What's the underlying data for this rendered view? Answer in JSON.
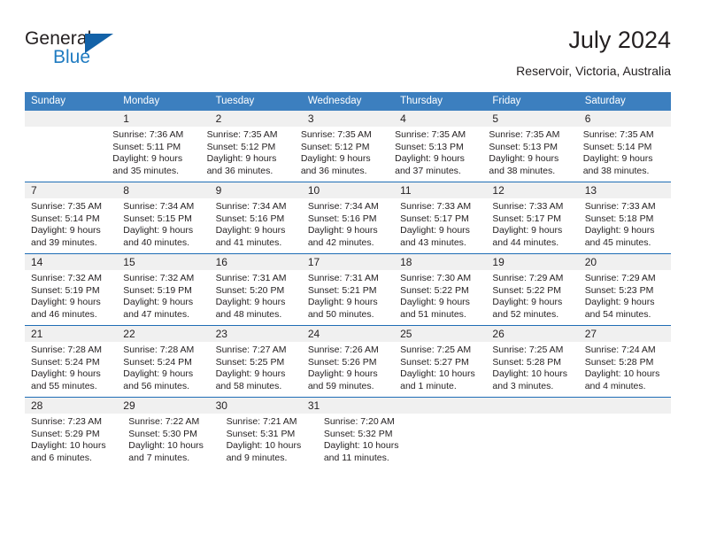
{
  "brand": {
    "name_top": "General",
    "name_bottom": "Blue",
    "accent_color": "#1362a8",
    "blue_text_color": "#1f7bc1",
    "triangle_icon": "triangle-icon"
  },
  "header": {
    "title": "July 2024",
    "subtitle": "Reservoir, Victoria, Australia"
  },
  "colors": {
    "header_row_bg": "#3c7fbf",
    "week_separator": "#1f6db5",
    "daynum_band_bg": "#f0f0f0",
    "text": "#231f20"
  },
  "weekdays": [
    "Sunday",
    "Monday",
    "Tuesday",
    "Wednesday",
    "Thursday",
    "Friday",
    "Saturday"
  ],
  "weeks": [
    {
      "days": [
        {
          "num": "",
          "lines": []
        },
        {
          "num": "1",
          "lines": [
            "Sunrise: 7:36 AM",
            "Sunset: 5:11 PM",
            "Daylight: 9 hours",
            "and 35 minutes."
          ]
        },
        {
          "num": "2",
          "lines": [
            "Sunrise: 7:35 AM",
            "Sunset: 5:12 PM",
            "Daylight: 9 hours",
            "and 36 minutes."
          ]
        },
        {
          "num": "3",
          "lines": [
            "Sunrise: 7:35 AM",
            "Sunset: 5:12 PM",
            "Daylight: 9 hours",
            "and 36 minutes."
          ]
        },
        {
          "num": "4",
          "lines": [
            "Sunrise: 7:35 AM",
            "Sunset: 5:13 PM",
            "Daylight: 9 hours",
            "and 37 minutes."
          ]
        },
        {
          "num": "5",
          "lines": [
            "Sunrise: 7:35 AM",
            "Sunset: 5:13 PM",
            "Daylight: 9 hours",
            "and 38 minutes."
          ]
        },
        {
          "num": "6",
          "lines": [
            "Sunrise: 7:35 AM",
            "Sunset: 5:14 PM",
            "Daylight: 9 hours",
            "and 38 minutes."
          ]
        }
      ]
    },
    {
      "days": [
        {
          "num": "7",
          "lines": [
            "Sunrise: 7:35 AM",
            "Sunset: 5:14 PM",
            "Daylight: 9 hours",
            "and 39 minutes."
          ]
        },
        {
          "num": "8",
          "lines": [
            "Sunrise: 7:34 AM",
            "Sunset: 5:15 PM",
            "Daylight: 9 hours",
            "and 40 minutes."
          ]
        },
        {
          "num": "9",
          "lines": [
            "Sunrise: 7:34 AM",
            "Sunset: 5:16 PM",
            "Daylight: 9 hours",
            "and 41 minutes."
          ]
        },
        {
          "num": "10",
          "lines": [
            "Sunrise: 7:34 AM",
            "Sunset: 5:16 PM",
            "Daylight: 9 hours",
            "and 42 minutes."
          ]
        },
        {
          "num": "11",
          "lines": [
            "Sunrise: 7:33 AM",
            "Sunset: 5:17 PM",
            "Daylight: 9 hours",
            "and 43 minutes."
          ]
        },
        {
          "num": "12",
          "lines": [
            "Sunrise: 7:33 AM",
            "Sunset: 5:17 PM",
            "Daylight: 9 hours",
            "and 44 minutes."
          ]
        },
        {
          "num": "13",
          "lines": [
            "Sunrise: 7:33 AM",
            "Sunset: 5:18 PM",
            "Daylight: 9 hours",
            "and 45 minutes."
          ]
        }
      ]
    },
    {
      "days": [
        {
          "num": "14",
          "lines": [
            "Sunrise: 7:32 AM",
            "Sunset: 5:19 PM",
            "Daylight: 9 hours",
            "and 46 minutes."
          ]
        },
        {
          "num": "15",
          "lines": [
            "Sunrise: 7:32 AM",
            "Sunset: 5:19 PM",
            "Daylight: 9 hours",
            "and 47 minutes."
          ]
        },
        {
          "num": "16",
          "lines": [
            "Sunrise: 7:31 AM",
            "Sunset: 5:20 PM",
            "Daylight: 9 hours",
            "and 48 minutes."
          ]
        },
        {
          "num": "17",
          "lines": [
            "Sunrise: 7:31 AM",
            "Sunset: 5:21 PM",
            "Daylight: 9 hours",
            "and 50 minutes."
          ]
        },
        {
          "num": "18",
          "lines": [
            "Sunrise: 7:30 AM",
            "Sunset: 5:22 PM",
            "Daylight: 9 hours",
            "and 51 minutes."
          ]
        },
        {
          "num": "19",
          "lines": [
            "Sunrise: 7:29 AM",
            "Sunset: 5:22 PM",
            "Daylight: 9 hours",
            "and 52 minutes."
          ]
        },
        {
          "num": "20",
          "lines": [
            "Sunrise: 7:29 AM",
            "Sunset: 5:23 PM",
            "Daylight: 9 hours",
            "and 54 minutes."
          ]
        }
      ]
    },
    {
      "days": [
        {
          "num": "21",
          "lines": [
            "Sunrise: 7:28 AM",
            "Sunset: 5:24 PM",
            "Daylight: 9 hours",
            "and 55 minutes."
          ]
        },
        {
          "num": "22",
          "lines": [
            "Sunrise: 7:28 AM",
            "Sunset: 5:24 PM",
            "Daylight: 9 hours",
            "and 56 minutes."
          ]
        },
        {
          "num": "23",
          "lines": [
            "Sunrise: 7:27 AM",
            "Sunset: 5:25 PM",
            "Daylight: 9 hours",
            "and 58 minutes."
          ]
        },
        {
          "num": "24",
          "lines": [
            "Sunrise: 7:26 AM",
            "Sunset: 5:26 PM",
            "Daylight: 9 hours",
            "and 59 minutes."
          ]
        },
        {
          "num": "25",
          "lines": [
            "Sunrise: 7:25 AM",
            "Sunset: 5:27 PM",
            "Daylight: 10 hours",
            "and 1 minute."
          ]
        },
        {
          "num": "26",
          "lines": [
            "Sunrise: 7:25 AM",
            "Sunset: 5:28 PM",
            "Daylight: 10 hours",
            "and 3 minutes."
          ]
        },
        {
          "num": "27",
          "lines": [
            "Sunrise: 7:24 AM",
            "Sunset: 5:28 PM",
            "Daylight: 10 hours",
            "and 4 minutes."
          ]
        }
      ]
    },
    {
      "days": [
        {
          "num": "28",
          "lines": [
            "Sunrise: 7:23 AM",
            "Sunset: 5:29 PM",
            "Daylight: 10 hours",
            "and 6 minutes."
          ]
        },
        {
          "num": "29",
          "lines": [
            "Sunrise: 7:22 AM",
            "Sunset: 5:30 PM",
            "Daylight: 10 hours",
            "and 7 minutes."
          ]
        },
        {
          "num": "30",
          "lines": [
            "Sunrise: 7:21 AM",
            "Sunset: 5:31 PM",
            "Daylight: 10 hours",
            "and 9 minutes."
          ]
        },
        {
          "num": "31",
          "lines": [
            "Sunrise: 7:20 AM",
            "Sunset: 5:32 PM",
            "Daylight: 10 hours",
            "and 11 minutes."
          ]
        },
        {
          "num": "",
          "lines": []
        },
        {
          "num": "",
          "lines": []
        },
        {
          "num": "",
          "lines": []
        }
      ]
    }
  ]
}
